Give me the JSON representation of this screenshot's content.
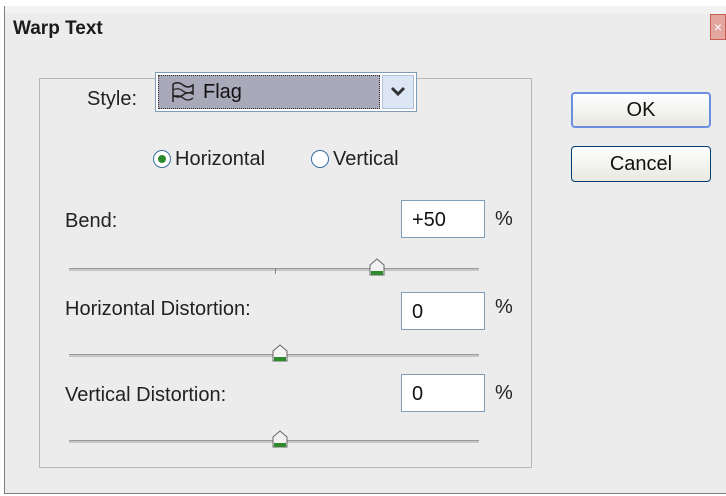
{
  "window": {
    "title": "Warp Text",
    "close_glyph": "×"
  },
  "style": {
    "label": "Style:",
    "value": "Flag",
    "icon": "flag-icon"
  },
  "orientation": {
    "horizontal_label": "Horizontal",
    "vertical_label": "Vertical",
    "selected": "Horizontal"
  },
  "bend": {
    "label": "Bend:",
    "value": "+50",
    "unit": "%",
    "level": 50
  },
  "horizontal_distortion": {
    "label": "Horizontal Distortion:",
    "value": "0",
    "unit": "%",
    "level": 0
  },
  "vertical_distortion": {
    "label": "Vertical Distortion:",
    "value": "0",
    "unit": "%",
    "level": 0
  },
  "buttons": {
    "ok_label": "OK",
    "cancel_label": "Cancel"
  },
  "colors": {
    "accent_green": "#2d8a2d",
    "button_border": "#003c74",
    "selection_bg": "#a9a9b9"
  }
}
